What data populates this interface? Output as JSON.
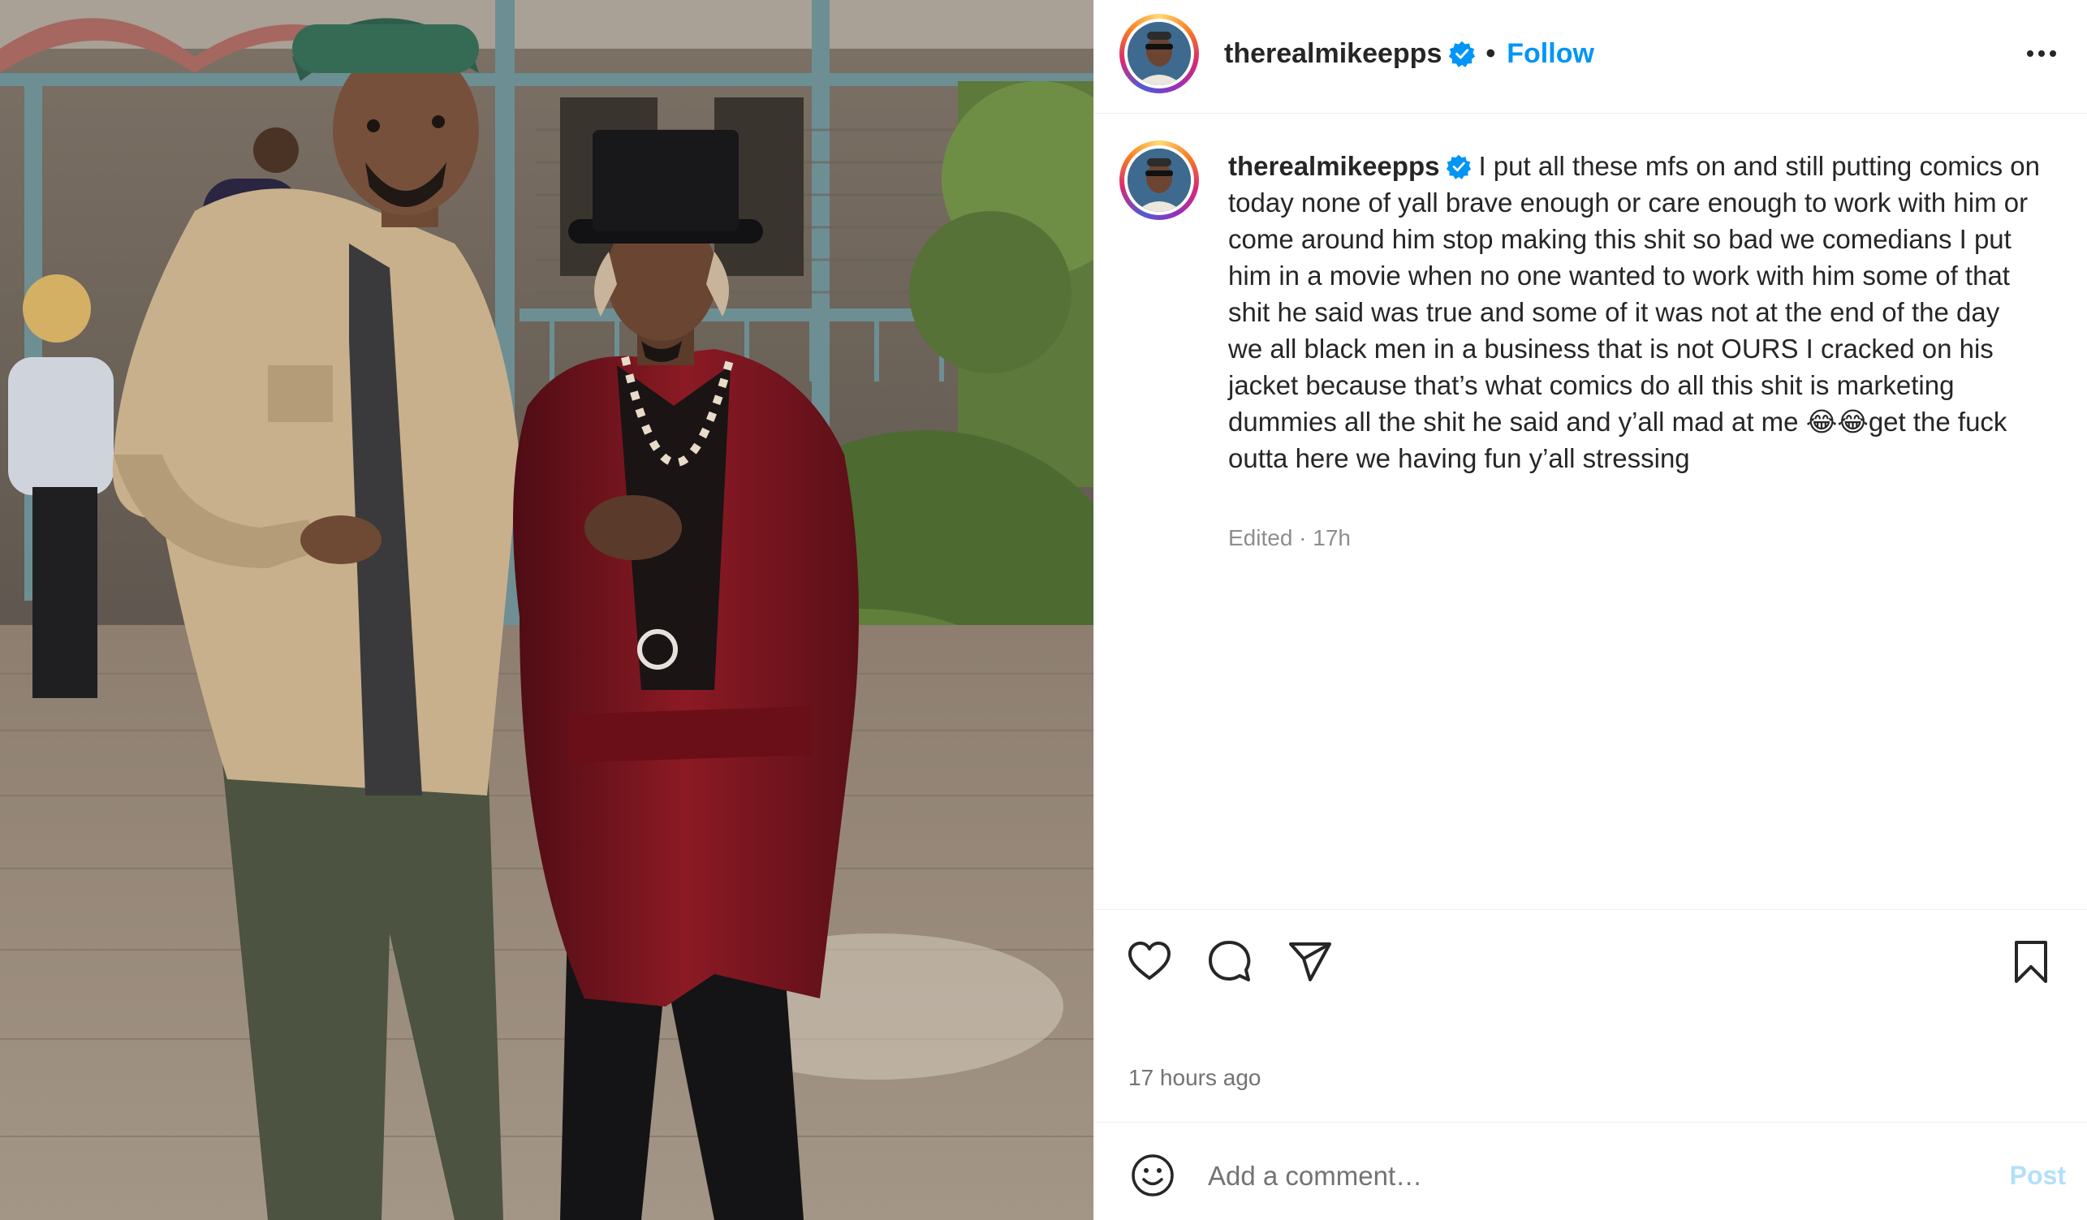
{
  "header": {
    "username": "therealmikeepps",
    "separator": "•",
    "follow_label": "Follow",
    "more_icon": "more-horizontal-icon"
  },
  "caption": {
    "username": "therealmikeepps",
    "text_before_emoji": "I put all these mfs on and still putting comics on today none of yall brave enough or care enough to work with him or come around him stop making this shit so bad we comedians I put him in a movie when no one wanted to work with him some of that shit he said was true and some of it was not at the end of the day we all black men in a business that is not OURS I cracked on his jacket because that’s what comics do all this shit is marketing dummies all the shit he said and y’all mad at me",
    "emoji": [
      "😂",
      "😂"
    ],
    "text_after_emoji": "get the fuck outta here we having fun y’all stressing",
    "meta": "Edited · 17h"
  },
  "actions": {
    "like_icon": "heart-icon",
    "comment_icon": "comment-icon",
    "share_icon": "send-icon",
    "save_icon": "bookmark-icon",
    "time_ago": "17 hours ago"
  },
  "comment": {
    "placeholder": "Add a comment…",
    "post_label": "Post"
  },
  "colors": {
    "link_blue": "#0095f6",
    "post_disabled": "#b2dffc",
    "verified_blue": "#0095f6",
    "secondary_text": "#737373"
  }
}
